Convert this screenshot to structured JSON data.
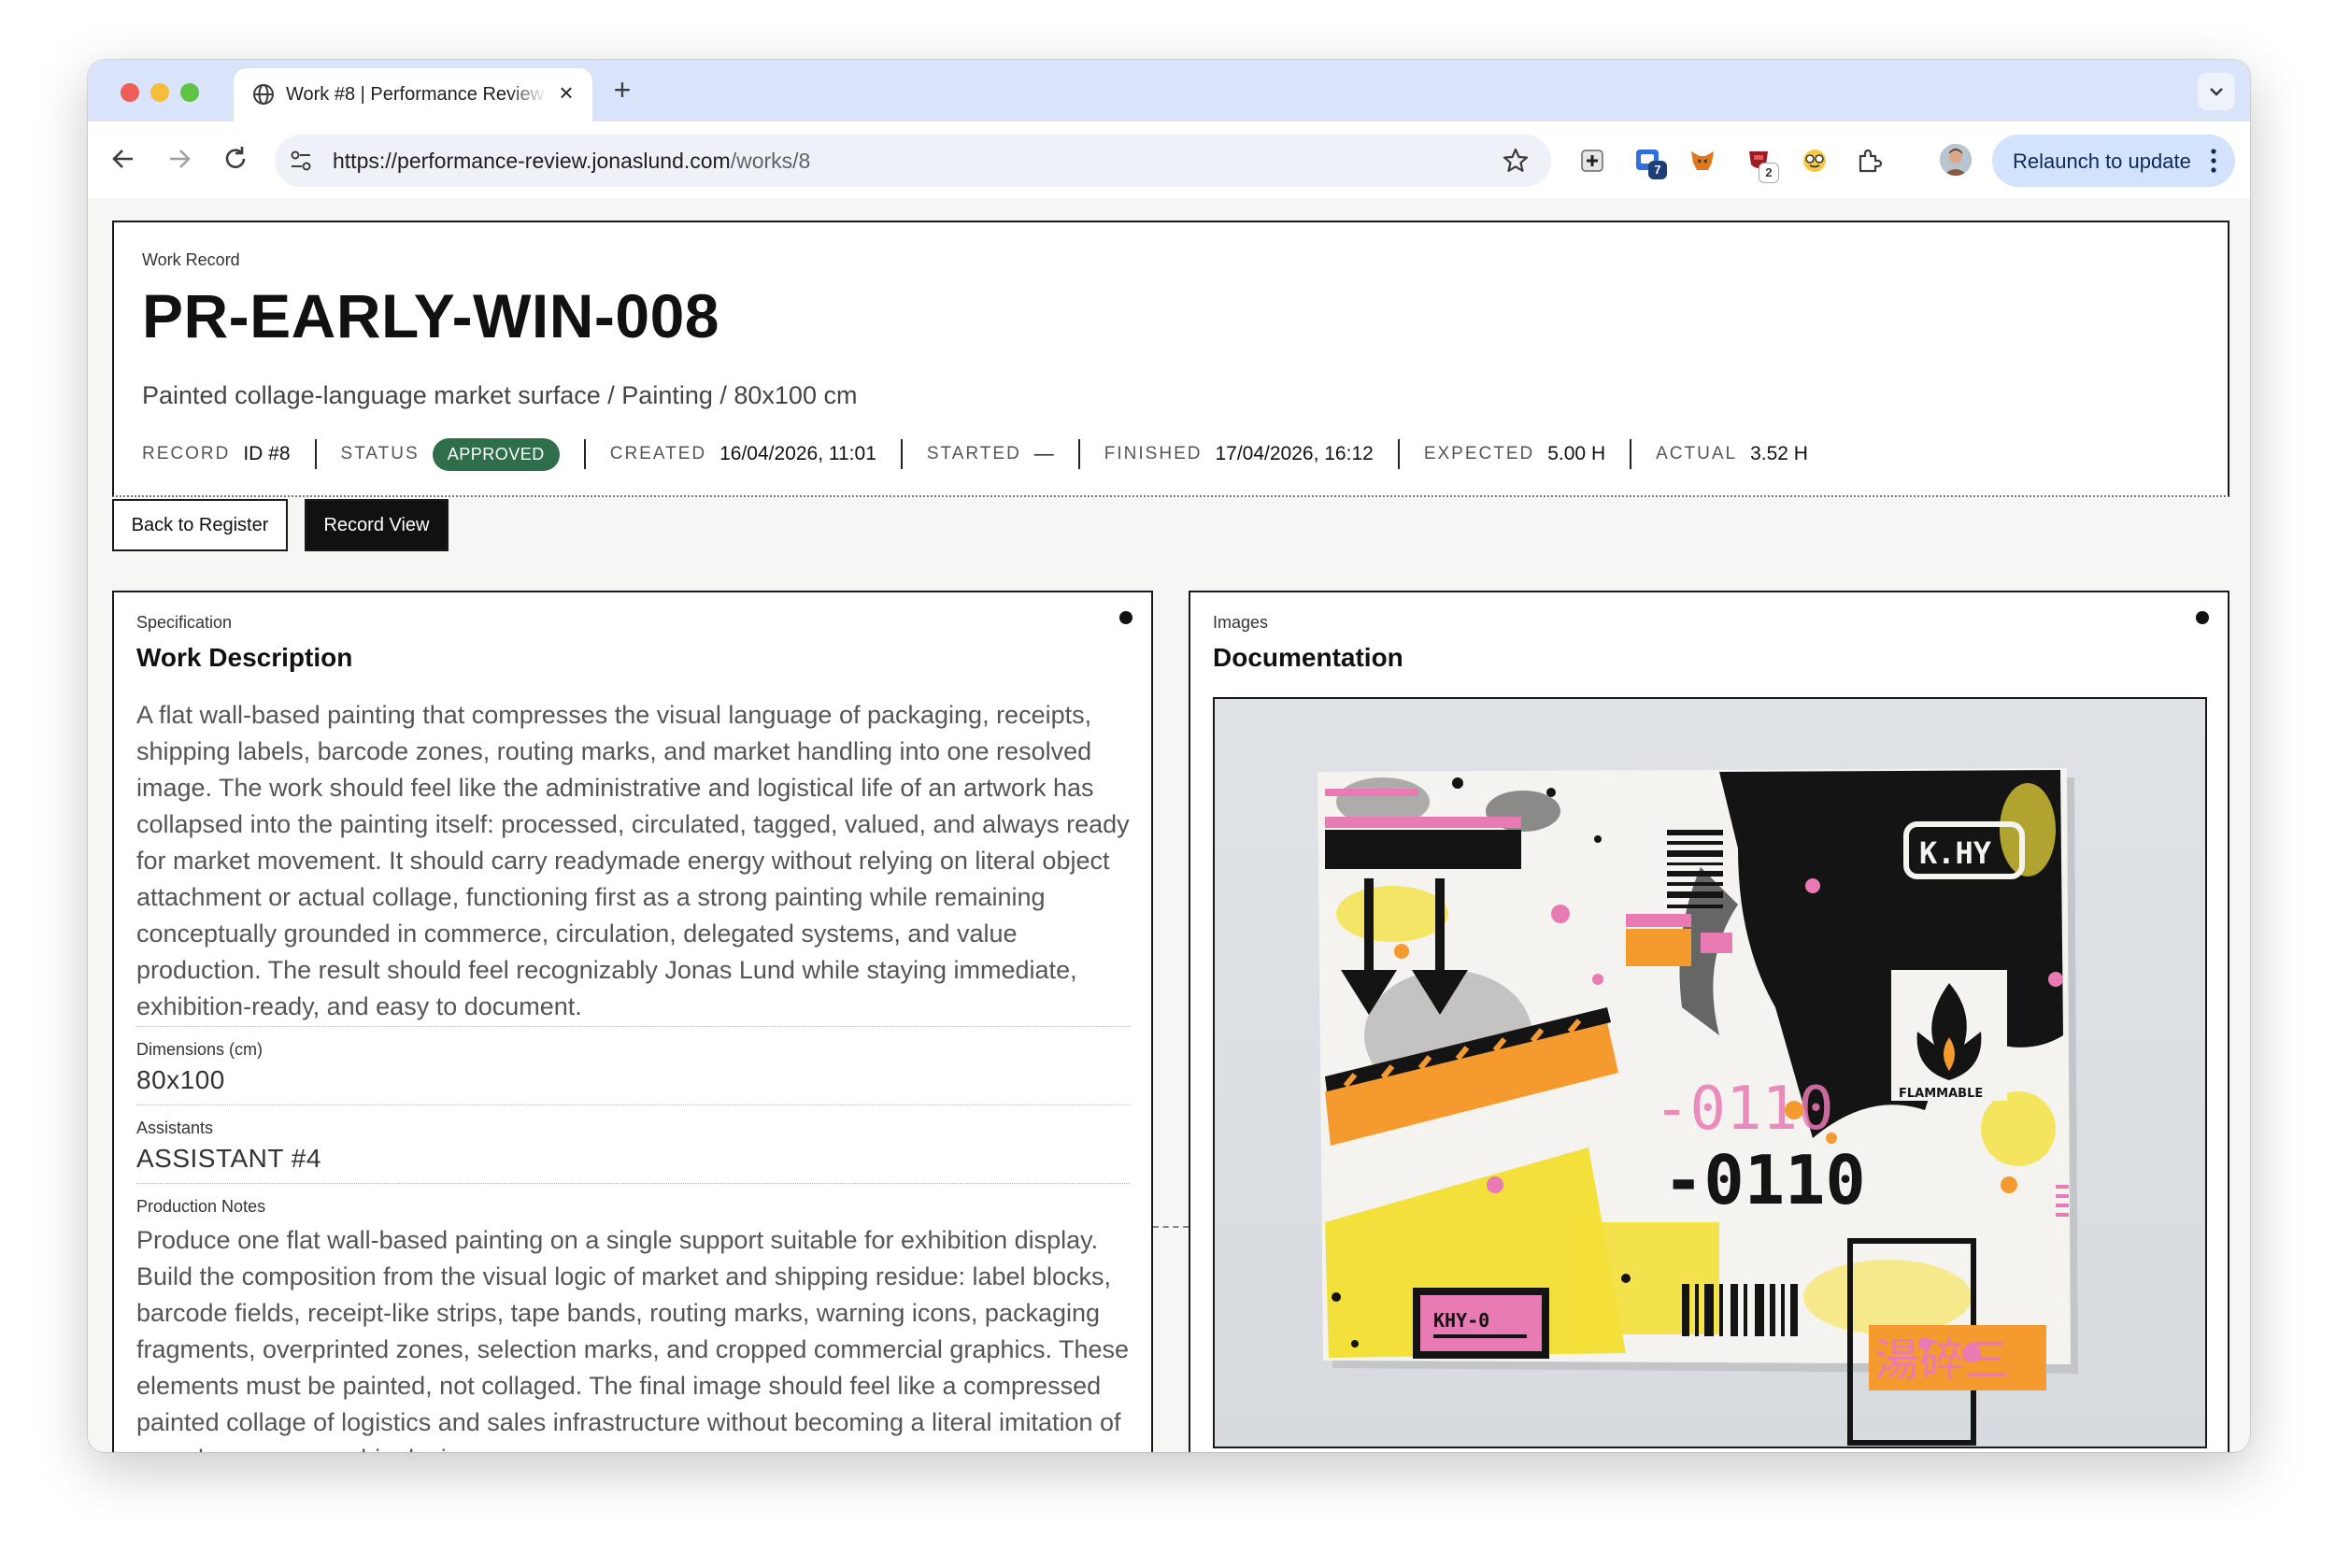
{
  "browser": {
    "tab_title": "Work #8 | Performance Review",
    "url_host": "https://performance-review.jonaslund.com",
    "url_path": "/works/8",
    "relaunch_label": "Relaunch to update",
    "extension_badges": {
      "tab_manager": "7",
      "shield": "2"
    }
  },
  "record": {
    "eyebrow": "Work Record",
    "title": "PR-EARLY-WIN-008",
    "subtitle": "Painted collage-language market surface / Painting / 80x100 cm",
    "meta": {
      "record_label": "RECORD",
      "record_value": "ID #8",
      "status_label": "STATUS",
      "status_value": "APPROVED",
      "created_label": "CREATED",
      "created_value": "16/04/2026, 11:01",
      "started_label": "STARTED",
      "started_value": "—",
      "finished_label": "FINISHED",
      "finished_value": "17/04/2026, 16:12",
      "expected_label": "EXPECTED",
      "expected_value": "5.00 H",
      "actual_label": "ACTUAL",
      "actual_value": "3.52 H"
    }
  },
  "actions": {
    "back_label": "Back to Register",
    "record_view_label": "Record View"
  },
  "specification": {
    "eyebrow": "Specification",
    "title": "Work Description",
    "description": "A flat wall-based painting that compresses the visual language of packaging, receipts, shipping labels, barcode zones, routing marks, and market handling into one resolved image. The work should feel like the administrative and logistical life of an artwork has collapsed into the painting itself: processed, circulated, tagged, valued, and always ready for market movement. It should carry readymade energy without relying on literal object attachment or actual collage, functioning first as a strong painting while remaining conceptually grounded in commerce, circulation, delegated systems, and value production. The result should feel recognizably Jonas Lund while staying immediate, exhibition-ready, and easy to document.",
    "dimensions_label": "Dimensions (cm)",
    "dimensions_value": "80x100",
    "assistants_label": "Assistants",
    "assistants_value": "ASSISTANT #4",
    "notes_label": "Production Notes",
    "notes_value": "Produce one flat wall-based painting on a single support suitable for exhibition display. Build the composition from the visual logic of market and shipping residue: label blocks, barcode fields, receipt-like strips, tape bands, routing marks, warning icons, packaging fragments, overprinted zones, selection marks, and cropped commercial graphics. These elements must be painted, not collaged. The final image should feel like a compressed painted collage of logistics and sales infrastructure without becoming a literal imitation of a package or a graphic design"
  },
  "images": {
    "eyebrow": "Images",
    "title": "Documentation",
    "painting_text": {
      "tag": "K.HY",
      "code_pink": "-0110",
      "code_black": "-0110",
      "flammable": "FLAMMABLE",
      "label": "KHY-0",
      "glyphs": "湯碎三"
    },
    "colors": {
      "yellow": "#f4e03a",
      "orange": "#f59a2f",
      "pink": "#e87bb4",
      "black": "#141414"
    }
  }
}
